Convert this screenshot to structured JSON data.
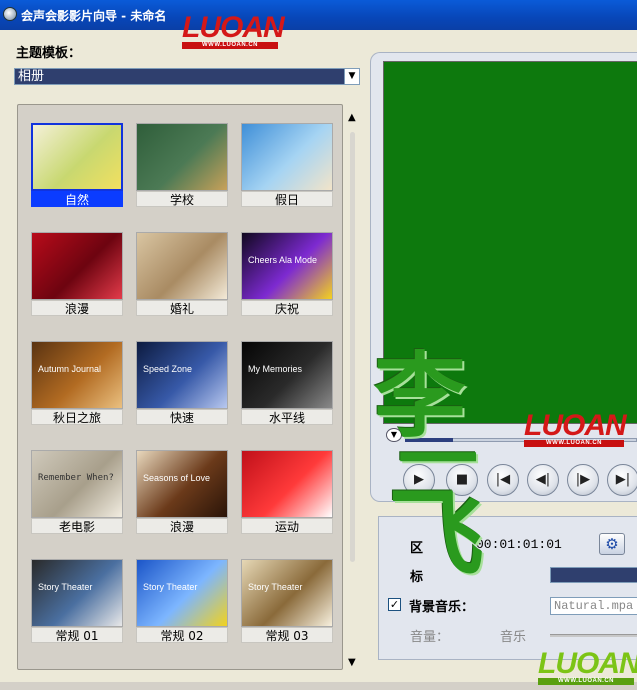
{
  "window": {
    "title": "会声会影影片向导 - 未命名"
  },
  "watermark": {
    "big": "LUOAN",
    "small": "WWW.LUOAN.CN"
  },
  "theme": {
    "label": "主题模板：",
    "selected": "相册",
    "dropdown_icon": "chevron-down-icon"
  },
  "templates": [
    {
      "label": "自然",
      "selected": true,
      "colors": [
        "#f4f0d8",
        "#c8d870",
        "#f2e060"
      ]
    },
    {
      "label": "学校",
      "colors": [
        "#2f5e3a",
        "#4c7a55",
        "#c8a15a"
      ]
    },
    {
      "label": "假日",
      "colors": [
        "#3f8fd8",
        "#a6d4f3",
        "#f2e4c9"
      ]
    },
    {
      "label": "浪漫",
      "colors": [
        "#b80b1a",
        "#6d0410",
        "#e33b4a"
      ]
    },
    {
      "label": "婚礼",
      "colors": [
        "#d9c5a2",
        "#a98b63",
        "#f3ead8"
      ]
    },
    {
      "label": "庆祝",
      "colors": [
        "#10081f",
        "#7d2ad1",
        "#f4d21f"
      ],
      "overlay": "Cheers Ala Mode"
    },
    {
      "label": "秋日之旅",
      "colors": [
        "#5a3311",
        "#b26b22",
        "#eac080"
      ],
      "overlay": "Autumn Journal"
    },
    {
      "label": "快速",
      "colors": [
        "#0d1b40",
        "#3759a8",
        "#b8c8ef"
      ],
      "overlay": "Speed Zone"
    },
    {
      "label": "水平线",
      "colors": [
        "#050505",
        "#2a2a2a",
        "#8a8a8a"
      ],
      "overlay": "My Memories"
    },
    {
      "label": "老电影",
      "colors": [
        "#cfc9bb",
        "#a89f8b",
        "#f1ece0"
      ],
      "overlay": "Remember When?"
    },
    {
      "label": "浪漫",
      "colors": [
        "#e8d8bd",
        "#6b3a1a",
        "#2a1408"
      ],
      "overlay": "Seasons of Love"
    },
    {
      "label": "运动",
      "colors": [
        "#c0101a",
        "#ff3a3a",
        "#ffffff"
      ]
    },
    {
      "label": "常规 01",
      "colors": [
        "#2a2a2a",
        "#4a6fa0",
        "#e8e8e8"
      ],
      "overlay": "Story Theater"
    },
    {
      "label": "常规 02",
      "colors": [
        "#1b55c8",
        "#7db6ff",
        "#f2d21e"
      ],
      "overlay": "Story Theater"
    },
    {
      "label": "常规 03",
      "colors": [
        "#e6d8b6",
        "#8a6a3a",
        "#f7f0de"
      ],
      "overlay": "Story Theater"
    }
  ],
  "preview": {
    "screen_color": "#0d790d"
  },
  "controls": [
    {
      "name": "play-button",
      "icon": "play-icon",
      "glyph": "▶"
    },
    {
      "name": "stop-button",
      "icon": "stop-icon",
      "glyph": "■"
    },
    {
      "name": "go-start-button",
      "icon": "skip-start-icon",
      "glyph": "|◀"
    },
    {
      "name": "prev-frame-button",
      "icon": "step-back-icon",
      "glyph": "◀|"
    },
    {
      "name": "next-frame-button",
      "icon": "step-forward-icon",
      "glyph": "|▶"
    },
    {
      "name": "go-end-button",
      "icon": "skip-end-icon",
      "glyph": "▶|"
    }
  ],
  "properties": {
    "duration_label": "区",
    "duration_value": "00:01:01:01",
    "title_label": "标",
    "music_checked": true,
    "music_label": "背景音乐：",
    "music_file": "Natural.mpa",
    "volume_label": "音量：",
    "music_sub_label": "音乐",
    "settings_icon": "gear-icon"
  },
  "overlay_chars": {
    "char1": "李",
    "char2": "一",
    "char3": "飞"
  }
}
